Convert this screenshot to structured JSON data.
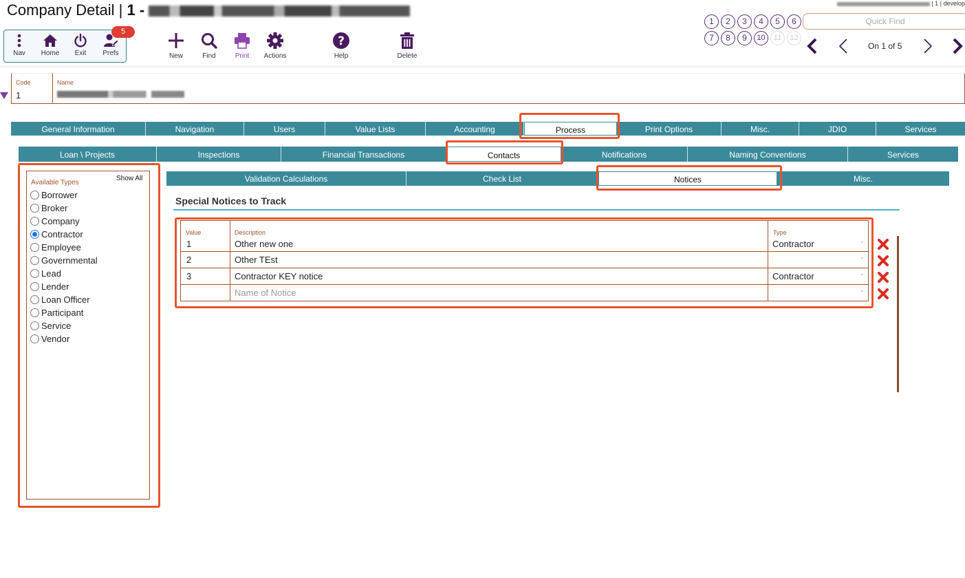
{
  "header": {
    "title_prefix": "Company Detail |",
    "title_record": "1 -",
    "user_info_suffix": "| 1 | develop"
  },
  "toolbar": {
    "nav_label": "Nav",
    "home_label": "Home",
    "exit_label": "Exit",
    "prefs_label": "Prefs",
    "prefs_badge": "5",
    "new_label": "New",
    "find_label": "Find",
    "print_label": "Print",
    "actions_label": "Actions",
    "help_label": "Help",
    "delete_label": "Delete"
  },
  "recent_records": [
    "1",
    "2",
    "3",
    "4",
    "5",
    "6",
    "7",
    "8",
    "9",
    "10",
    "11",
    "12"
  ],
  "quick_find": {
    "placeholder": "Quick Find"
  },
  "pager": {
    "text": "On 1 of 5"
  },
  "record": {
    "code_label": "Code",
    "code_value": "1",
    "name_label": "Name"
  },
  "tabs_level1": [
    "General Information",
    "Navigation",
    "Users",
    "Value Lists",
    "Accounting",
    "Process",
    "Print Options",
    "Misc.",
    "JDIO",
    "Services"
  ],
  "tabs_level2": [
    "Loan \\ Projects",
    "Inspections",
    "Financial Transactions",
    "Contacts",
    "Notifications",
    "Naming Conventions",
    "Services"
  ],
  "tabs_level3": [
    "Validation Calculations",
    "Check List",
    "Notices",
    "Misc."
  ],
  "types_panel": {
    "title": "Available Types",
    "show_all": "Show All",
    "items": [
      "Borrower",
      "Broker",
      "Company",
      "Contractor",
      "Employee",
      "Governmental",
      "Lead",
      "Lender",
      "Loan Officer",
      "Participant",
      "Service",
      "Vendor"
    ],
    "selected": "Contractor"
  },
  "notices": {
    "section_title": "Special Notices to Track",
    "columns": {
      "value": "Value",
      "description": "Description",
      "type": "Type"
    },
    "rows": [
      {
        "value": "1",
        "description": "Other new one",
        "type": "Contractor"
      },
      {
        "value": "2",
        "description": "Other TEst",
        "type": ""
      },
      {
        "value": "3",
        "description": "Contractor KEY notice",
        "type": "Contractor"
      }
    ],
    "new_row_placeholder": "Name of Notice"
  },
  "colors": {
    "tab_bg": "#3b8a9a",
    "highlight": "#e8542a",
    "field_label": "#a0522d",
    "icon_purple": "#4a1a5e",
    "delete_red": "#d92b1f"
  }
}
